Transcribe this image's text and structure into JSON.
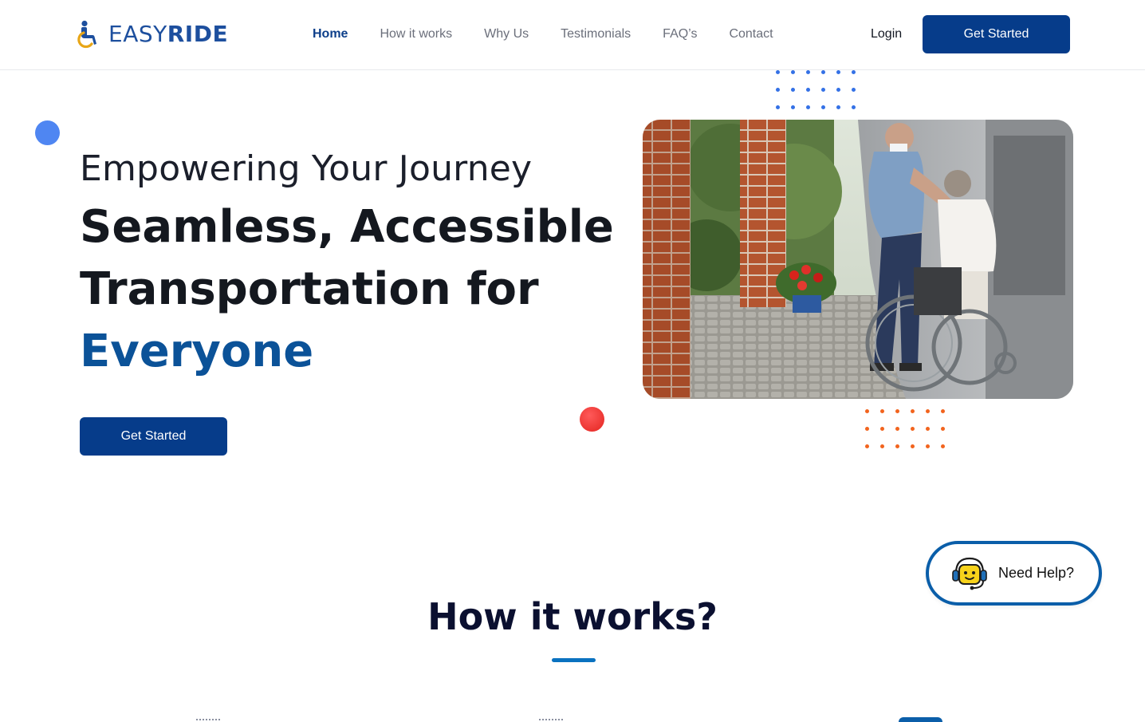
{
  "brand": {
    "name_part1": "EASY",
    "name_part2": "RIDE",
    "logo_icon": "wheelchair-icon",
    "color": "#1d4f9e"
  },
  "nav": {
    "items": [
      {
        "label": "Home",
        "active": true
      },
      {
        "label": "How it works",
        "active": false
      },
      {
        "label": "Why Us",
        "active": false
      },
      {
        "label": "Testimonials",
        "active": false
      },
      {
        "label": "FAQ’s",
        "active": false
      },
      {
        "label": "Contact",
        "active": false
      }
    ],
    "login_label": "Login",
    "cta_label": "Get Started"
  },
  "hero": {
    "kicker": "Empowering Your Journey",
    "title_line1": "Seamless, Accessible",
    "title_line2": "Transportation for",
    "title_accent": "Everyone",
    "cta_label": "Get Started",
    "image_icon": "caregiver-wheelchair-photo"
  },
  "help": {
    "label": "Need Help?",
    "icon": "support-headset-icon"
  },
  "how_it_works": {
    "title": "How it works?"
  },
  "colors": {
    "primary": "#063c8a",
    "accent_text": "#0b5298",
    "dot_blue": "#3471e6",
    "dot_orange": "#f2641e",
    "dot_red": "#e3241f",
    "underline": "#0a72c0"
  }
}
